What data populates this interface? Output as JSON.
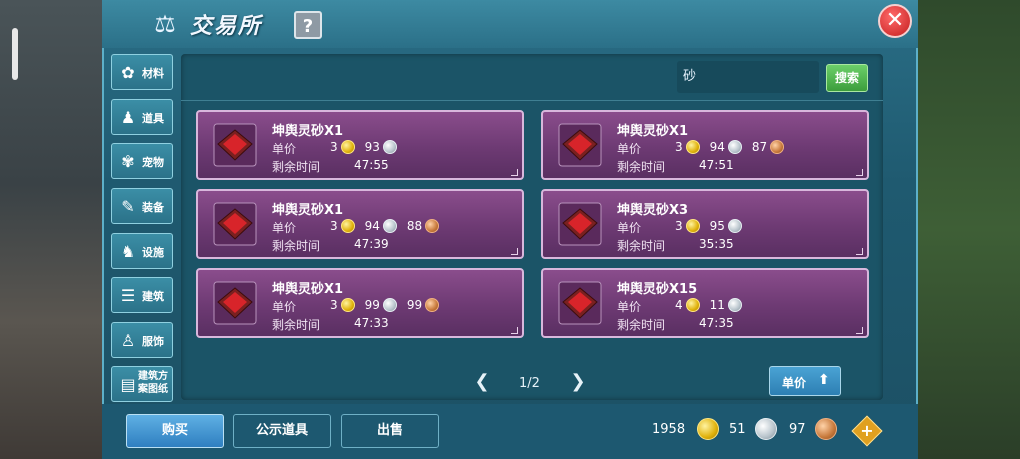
{
  "header": {
    "title": "交易所",
    "help_label": "?",
    "close_label": "✕"
  },
  "sidebar": {
    "items": [
      {
        "label": "材料",
        "icon": "materials-icon",
        "glyph": "✿"
      },
      {
        "label": "道具",
        "icon": "item-icon",
        "glyph": "♟"
      },
      {
        "label": "宠物",
        "icon": "pet-paw-icon",
        "glyph": "✾"
      },
      {
        "label": "装备",
        "icon": "equipment-icon",
        "glyph": "✎"
      },
      {
        "label": "设施",
        "icon": "facility-icon",
        "glyph": "♞"
      },
      {
        "label": "建筑",
        "icon": "building-icon",
        "glyph": "☰"
      },
      {
        "label": "服饰",
        "icon": "clothing-icon",
        "glyph": "♙"
      },
      {
        "label": "建筑方案图纸",
        "icon": "blueprint-icon",
        "glyph": "▤"
      }
    ]
  },
  "search": {
    "value": "砂",
    "button_label": "搜索"
  },
  "labels": {
    "unit_price": "单价",
    "remaining": "剩余时间"
  },
  "listings": [
    {
      "name": "坤舆灵砂X1",
      "gold": "3",
      "silver": "93",
      "copper": "",
      "time": "47:55"
    },
    {
      "name": "坤舆灵砂X1",
      "gold": "3",
      "silver": "94",
      "copper": "87",
      "time": "47:51"
    },
    {
      "name": "坤舆灵砂X1",
      "gold": "3",
      "silver": "94",
      "copper": "88",
      "time": "47:39"
    },
    {
      "name": "坤舆灵砂X3",
      "gold": "3",
      "silver": "95",
      "copper": "",
      "time": "35:35"
    },
    {
      "name": "坤舆灵砂X1",
      "gold": "3",
      "silver": "99",
      "copper": "99",
      "time": "47:33"
    },
    {
      "name": "坤舆灵砂X15",
      "gold": "4",
      "silver": "11",
      "copper": "",
      "time": "47:35"
    }
  ],
  "pager": {
    "text": "1/2",
    "prev": "❮",
    "next": "❯"
  },
  "sort": {
    "label": "单价",
    "icon": "sort-arrow-up-icon"
  },
  "actions": {
    "buy": "购买",
    "public": "公示道具",
    "sell": "出售"
  },
  "wallet": {
    "gold": "1958",
    "silver": "51",
    "copper": "97"
  }
}
